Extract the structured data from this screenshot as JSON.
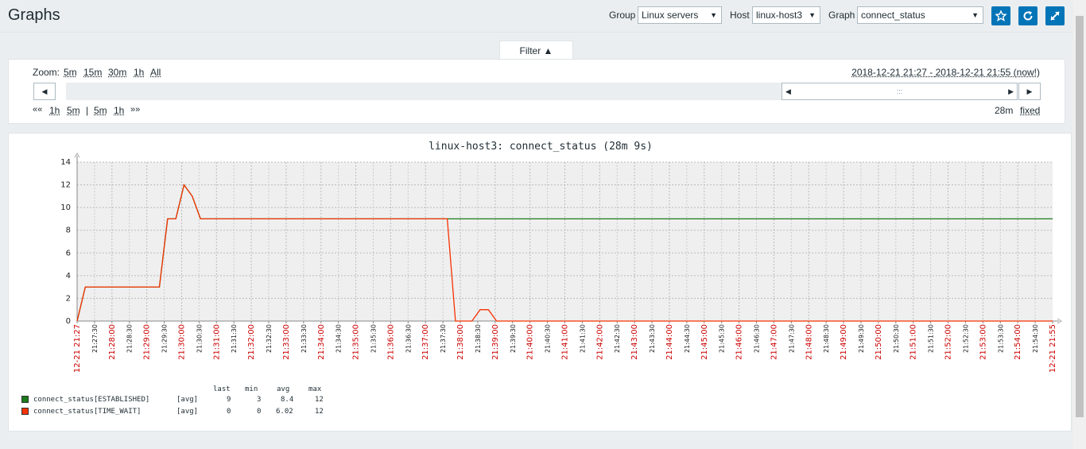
{
  "page": {
    "title": "Graphs"
  },
  "controls": {
    "group_label": "Group",
    "group_value": "Linux servers",
    "host_label": "Host",
    "host_value": "linux-host3",
    "graph_label": "Graph",
    "graph_value": "connect_status",
    "icons": [
      "star-icon",
      "refresh-icon",
      "fullscreen-icon"
    ],
    "accent_color": "#0275b8"
  },
  "filter": {
    "tab_label": "Filter ▲",
    "zoom_label": "Zoom:",
    "zoom_options": [
      "5m",
      "15m",
      "30m",
      "1h",
      "All"
    ],
    "range_from": "2018-12-21 21:27",
    "range_sep": " - ",
    "range_to": "2018-12-21 21:55 (now!)",
    "back_arrow": "««",
    "back_options": [
      "1h",
      "5m"
    ],
    "separator": "|",
    "fwd_options": [
      "5m",
      "1h"
    ],
    "fwd_arrow": "»»",
    "period": "28m",
    "fixed_label": "fixed",
    "selector_grip": ":::"
  },
  "chart_data": {
    "type": "line",
    "title": "linux-host3: connect_status (28m 9s)",
    "xlabel": "",
    "ylabel": "",
    "ylim": [
      0,
      14
    ],
    "y_ticks": [
      "0",
      "2",
      "4",
      "6",
      "8",
      "10",
      "12",
      "14"
    ],
    "x_ticks": [
      "21:27:00",
      "21:27:30",
      "21:28:00",
      "21:28:30",
      "21:29:00",
      "21:29:30",
      "21:30:00",
      "21:30:30",
      "21:31:00",
      "21:31:30",
      "21:32:00",
      "21:32:30",
      "21:33:00",
      "21:33:30",
      "21:34:00",
      "21:34:30",
      "21:35:00",
      "21:35:30",
      "21:36:00",
      "21:36:30",
      "21:37:00",
      "21:37:30",
      "21:38:00",
      "21:38:30",
      "21:39:00",
      "21:39:30",
      "21:40:00",
      "21:40:30",
      "21:41:00",
      "21:41:30",
      "21:42:00",
      "21:42:30",
      "21:43:00",
      "21:43:30",
      "21:44:00",
      "21:44:30",
      "21:45:00",
      "21:45:30",
      "21:46:00",
      "21:46:30",
      "21:47:00",
      "21:47:30",
      "21:48:00",
      "21:48:30",
      "21:49:00",
      "21:49:30",
      "21:50:00",
      "21:50:30",
      "21:51:00",
      "21:51:30",
      "21:52:00",
      "21:52:30",
      "21:53:00",
      "21:53:30",
      "21:54:00",
      "21:54:30",
      "21:55:00"
    ],
    "start_label": "12-21 21:27",
    "end_label": "12-21 21:55",
    "series": [
      {
        "name": "connect_status[ESTABLISHED]",
        "color": "#1a7c1a",
        "x": [
          0,
          0.5,
          5,
          5.5,
          6,
          6.5,
          7,
          7.5,
          59.3
        ],
        "y": [
          0,
          3,
          3,
          9,
          9,
          12,
          11,
          9,
          9
        ]
      },
      {
        "name": "connect_status[TIME_WAIT]",
        "color": "#f63100",
        "x": [
          0,
          0.5,
          5,
          5.5,
          6,
          6.5,
          7,
          7.5,
          22.5,
          23,
          24,
          24.5,
          25,
          25.5,
          59.3
        ],
        "y": [
          0,
          3,
          3,
          9,
          9,
          12,
          11,
          9,
          9,
          0,
          0,
          1,
          1,
          0,
          0
        ]
      }
    ]
  },
  "legend": {
    "headers": [
      "last",
      "min",
      "avg",
      "max"
    ],
    "rows": [
      {
        "name": "connect_status[ESTABLISHED]",
        "func": "[avg]",
        "last": "9",
        "min": "3",
        "avg": "8.4",
        "max": "12",
        "color": "#1a7c1a"
      },
      {
        "name": "connect_status[TIME_WAIT]",
        "func": "[avg]",
        "last": "0",
        "min": "0",
        "avg": "6.02",
        "max": "12",
        "color": "#f63100"
      }
    ]
  }
}
